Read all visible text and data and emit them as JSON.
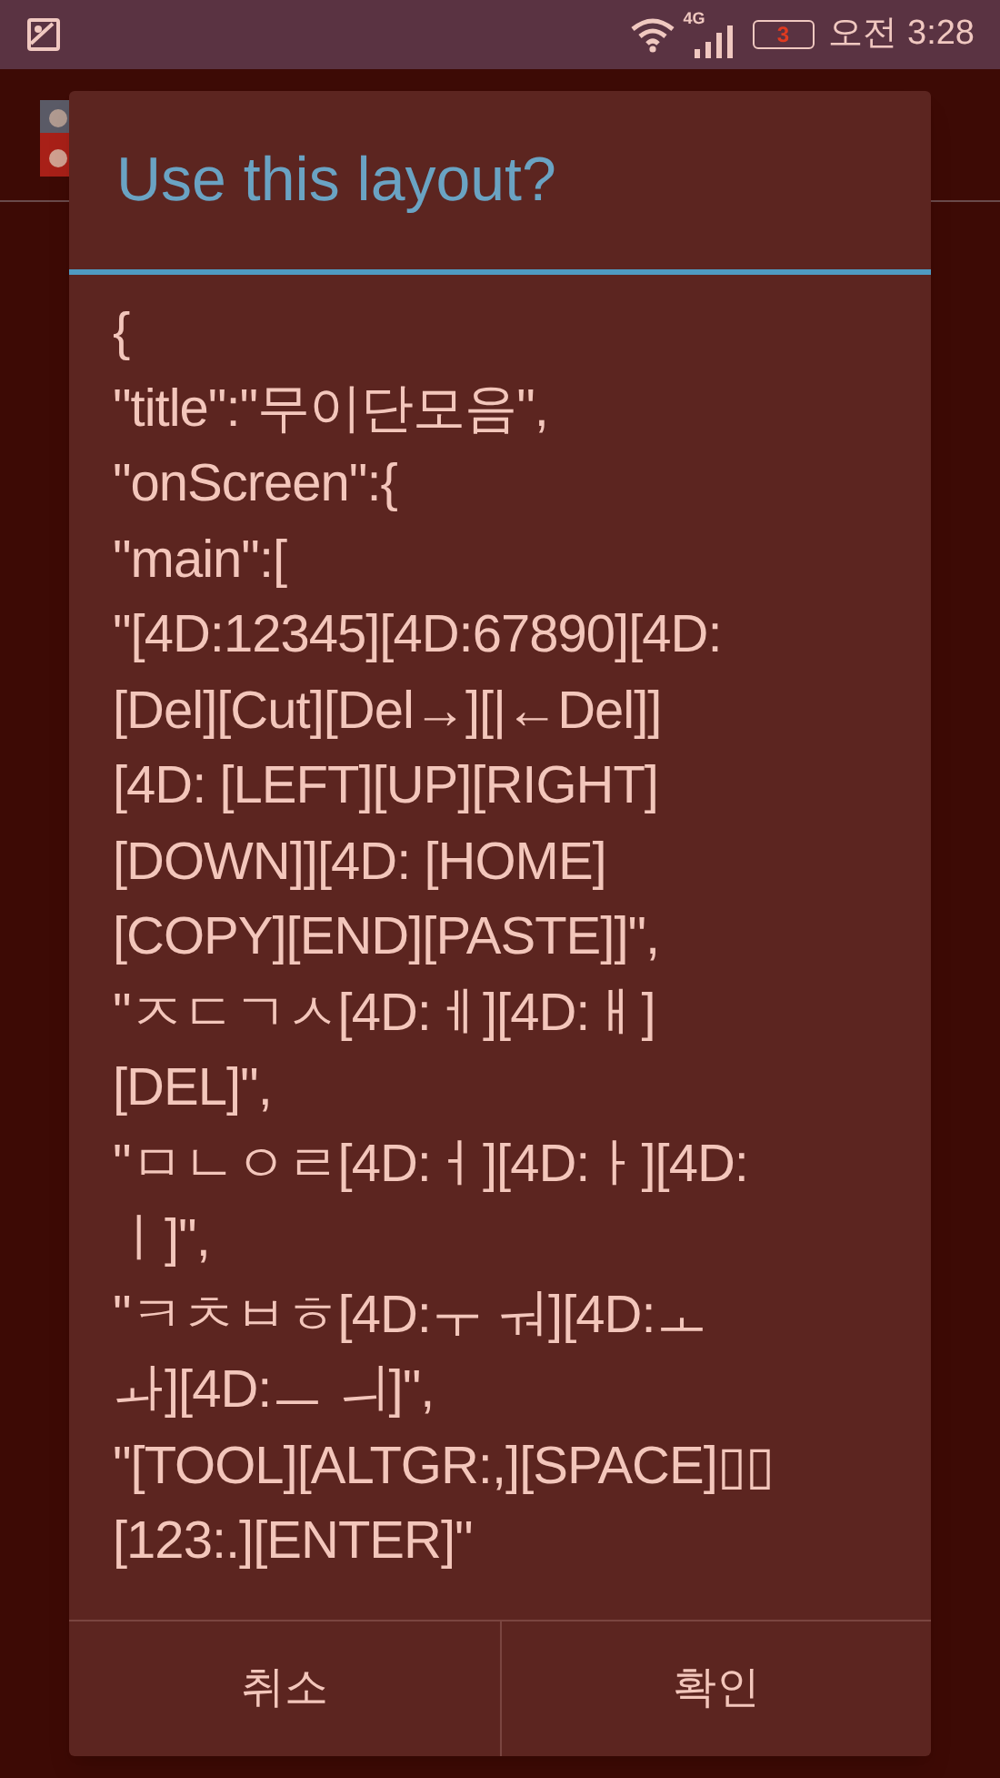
{
  "status_bar": {
    "network": "4G",
    "battery": "3",
    "time": "오전 3:28"
  },
  "dialog": {
    "title": "Use this layout?",
    "body_lines": [
      "{",
      "\"title\":\"무이단모음\",",
      "\"onScreen\":{",
      "\"main\":[",
      "\"[4D:12345][4D:67890][4D:",
      "[Del][Cut][Del→][|←Del]]",
      "[4D: [LEFT][UP][RIGHT]",
      "[DOWN]][4D: [HOME]",
      "[COPY][END][PASTE]]\",",
      "\"ㅈㄷㄱㅅ[4D:ㅔ][4D:ㅐ]",
      "[DEL]\",",
      "\"ㅁㄴㅇㄹ[4D:ㅓ][4D:ㅏ][4D:",
      "ㅣ]\",",
      "\"ㅋㅊㅂㅎ[4D:ㅜ ㅝ][4D:ㅗ",
      "ㅘ][4D:ㅡ ㅢ]\",",
      "\"[TOOL][ALTGR:,][SPACE]▯▯",
      "[123:.][ENTER]\""
    ],
    "buttons": [
      "취소",
      "확인"
    ]
  }
}
